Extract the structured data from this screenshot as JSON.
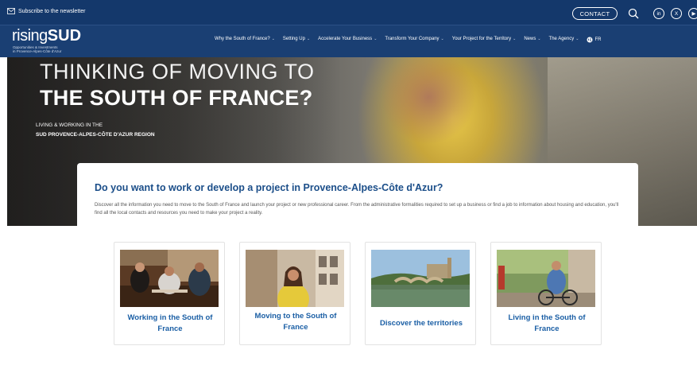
{
  "topbar": {
    "newsletter": "Subscribe to the newsletter",
    "contact": "CONTACT",
    "social": [
      "in",
      "X",
      "▶"
    ]
  },
  "navbar": {
    "logo_light": "rising",
    "logo_bold": "SUD",
    "logo_tagline_1": "Opportunities & Investments",
    "logo_tagline_2": "in Provence-Alpes-Côte d'Azur",
    "items": [
      "Why the South of France?",
      "Setting Up",
      "Accelerate Your Business",
      "Transform Your Company",
      "Your Project for the Territory",
      "News",
      "The Agency"
    ],
    "lang": "FR"
  },
  "hero": {
    "line1": "THINKING OF MOVING TO",
    "line2": "THE SOUTH OF FRANCE?",
    "sub1": "LIVING & WORKING IN THE",
    "sub2": "SUD PROVENCE-ALPES-CÔTE D'AZUR REGION"
  },
  "card": {
    "title": "Do you want to work or develop a project in Provence-Alpes-Côte d'Azur?",
    "description": "Discover all the information you need to move to the South of France and launch your project or new professional career. From the administrative formalities required to set up a business or find a job to information about housing and education, you'll find all the local contacts and resources you need to make your project a reality."
  },
  "tiles": [
    {
      "label": "Working in the South of France"
    },
    {
      "label": "Moving to the South of France"
    },
    {
      "label": "Discover the territories"
    },
    {
      "label": "Living in the South of France"
    }
  ],
  "colors": {
    "navy": "#14386b",
    "nav": "#1a3f73",
    "title_blue": "#1b4e89",
    "tile_blue": "#1b5fa5"
  }
}
